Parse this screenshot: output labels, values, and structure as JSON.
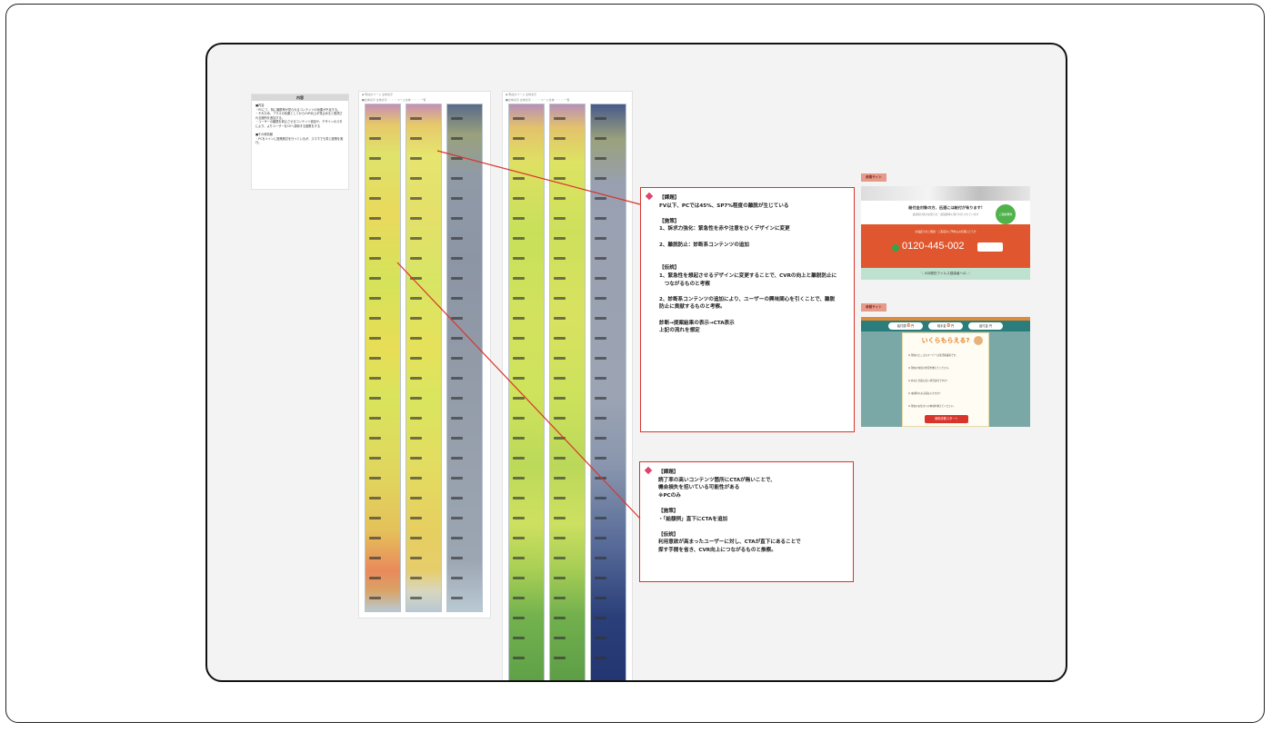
{
  "memo": {
    "title": "内容",
    "body": "■内容\n・PCにて、特に離脱率が見られるコンテンツの効果が不足する。\n・それため、プラスの効果としてからCVR向上が見込めると推測される箇所を追加する。\n・ユーザーの離脱を抑止させるコンテンツ追加や、デザインのスタにより、よりユーザーをCVへ誘導する施策をする\n\n■その他情報\n・PCをメインに施策検討を行っているが、スマホでも同じ施策を実行。"
  },
  "heatmap_left": {
    "header1": "◆ 現在のページ  全体表示",
    "header2": "■全体表示  全体表示  ・・・  ページ全体  ・・・  一覧",
    "strips": [
      "yellow-hot",
      "yellow-hot",
      "dark-cold"
    ]
  },
  "heatmap_right": {
    "header1": "◆ 現在のページ  全体表示",
    "header2": "■全体表示  全体表示  ・・・  ページ全体  ・・・  一覧",
    "strips": [
      "green-warm",
      "green-warm",
      "navy-cold"
    ]
  },
  "note1": {
    "lines": [
      "【課題】",
      "FV以下、PCでは45%、SP7%程度の離脱が生じている",
      "",
      "【施策】",
      "1、訴求力強化：緊急性を赤や注意をひくデザインに変更",
      "",
      "2、離脱防止：診断系コンテンツの追加",
      "",
      "",
      "【仮説】",
      "1、緊急性を想起させるデザインに変更することで、CVRの向上と離脱防止に",
      "　つながるものと考察",
      "",
      "2、診断系コンテンツの追加により、ユーザーの興味関心を引くことで、離脱",
      "防止に貢献するものと考察。",
      "",
      "診断→提案結果の表示→CTA表示",
      "上記の流れを想定"
    ]
  },
  "note2": {
    "lines": [
      "【課題】",
      "読了率の高いコンテンツ箇所にCTAが無いことで、",
      "機会損失を招いている可能性がある",
      "※PCのみ",
      "",
      "【施策】",
      "・「給額例」直下にCTAを追加",
      "",
      "【仮説】",
      "利用意欲が高まったユーザーに対し、CTAが直下にあることで",
      "探す手間を省き、CVR向上につながるものと推察。"
    ]
  },
  "ref_site_1": {
    "label": "参照サイト",
    "headline": "給付金対象の方、迅速には給付が有ります!",
    "sub": "最新給付金のお知らせ・最短簡単に受け付けされています",
    "banner": "お電話でのご相談・ご来店のご予約もお気軽にどうぞ",
    "phone": "0120-445-002",
    "badge_text": "ご相談無料",
    "footer_text": "＼ 8月現在ウイルス感染者への ／"
  },
  "ref_site_2": {
    "label": "参照サイト",
    "stat1": "給付額",
    "stat1_value": "0",
    "stat2": "相手金",
    "stat2_value": "0",
    "stat3": "給付金 ",
    "unit": "円",
    "title": "いくらもらえる?",
    "questions": [
      "Q 現在のところのスーパーは生活保護者です。",
      "Q 現在の住居の状況を教えてください。",
      "Q あなたが最も近い状況は何ですか?",
      "Q 未成年のお子様はいますか?",
      "Q 現在のお住まいの地域を教えてください。"
    ],
    "button": "無料診断スタート"
  },
  "colors": {
    "accent_red": "#d9342b",
    "diamond": "#e0436a",
    "ref_orange": "#e0572f",
    "ref_teal": "#7aa8a6"
  }
}
